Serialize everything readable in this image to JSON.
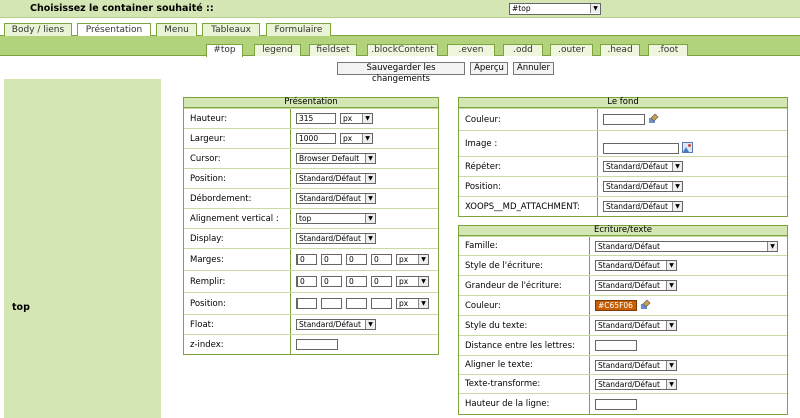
{
  "header": {
    "title": "Choisissez le container souhaité ::",
    "container_select": "#top"
  },
  "main_tabs": [
    {
      "label": "Body / liens"
    },
    {
      "label": "Présentation"
    },
    {
      "label": "Menu"
    },
    {
      "label": "Tableaux"
    },
    {
      "label": "Formulaire"
    }
  ],
  "sub_tabs": [
    {
      "label": "#top"
    },
    {
      "label": "legend"
    },
    {
      "label": "fieldset"
    },
    {
      "label": ".blockContent"
    },
    {
      "label": ".even"
    },
    {
      "label": ".odd"
    },
    {
      "label": ".outer"
    },
    {
      "label": ".head"
    },
    {
      "label": ".foot"
    }
  ],
  "actions": {
    "save": "Sauvegarder les changements",
    "preview": "Aperçu",
    "cancel": "Annuler"
  },
  "left_label": "top",
  "presentation": {
    "title": "Présentation",
    "height_label": "Hauteur:",
    "height_value": "315",
    "height_unit": "px",
    "width_label": "Largeur:",
    "width_value": "1000",
    "width_unit": "px",
    "cursor_label": "Cursor:",
    "cursor_value": "Browser Default",
    "position_label": "Position:",
    "position_value": "Standard/Défaut",
    "overflow_label": "Débordement:",
    "overflow_value": "Standard/Défaut",
    "valign_label": "Alignement vertical :",
    "valign_value": "top",
    "display_label": "Display:",
    "display_value": "Standard/Défaut",
    "margins_label": "Marges:",
    "margins": [
      "0",
      "0",
      "0",
      "0"
    ],
    "margins_unit": "px",
    "padding_label": "Remplir:",
    "padding": [
      "0",
      "0",
      "0",
      "0"
    ],
    "padding_unit": "px",
    "offset_label": "Position:",
    "offset_unit": "px",
    "float_label": "Float:",
    "float_value": "Standard/Défaut",
    "zindex_label": "z-index:"
  },
  "background": {
    "title": "Le fond",
    "color_label": "Couleur:",
    "image_label": "Image :",
    "repeat_label": "Répéter:",
    "repeat_value": "Standard/Défaut",
    "position_label": "Position:",
    "position_value": "Standard/Défaut",
    "attachment_label": "XOOPS__MD_ATTACHMENT:",
    "attachment_value": "Standard/Défaut"
  },
  "text": {
    "title": "Ecriture/texte",
    "family_label": "Famille:",
    "family_value": "Standard/Défaut",
    "style_label": "Style de l'écriture:",
    "style_value": "Standard/Défaut",
    "size_label": "Grandeur de l'écriture:",
    "size_value": "Standard/Défaut",
    "color_label": "Couleur:",
    "color_value": "#C65F06",
    "decoration_label": "Style du texte:",
    "decoration_value": "Standard/Défaut",
    "spacing_label": "Distance entre les lettres:",
    "align_label": "Aligner le texte:",
    "align_value": "Standard/Défaut",
    "transform_label": "Texte-transforme:",
    "transform_value": "Standard/Défaut",
    "lineheight_label": "Hauteur de la ligne:"
  },
  "colors": {
    "accent_green": "#7ba33e",
    "light_green": "#d4e6b4",
    "bar_green": "#b3d27c",
    "text_color_swatch": "#C65F06"
  }
}
